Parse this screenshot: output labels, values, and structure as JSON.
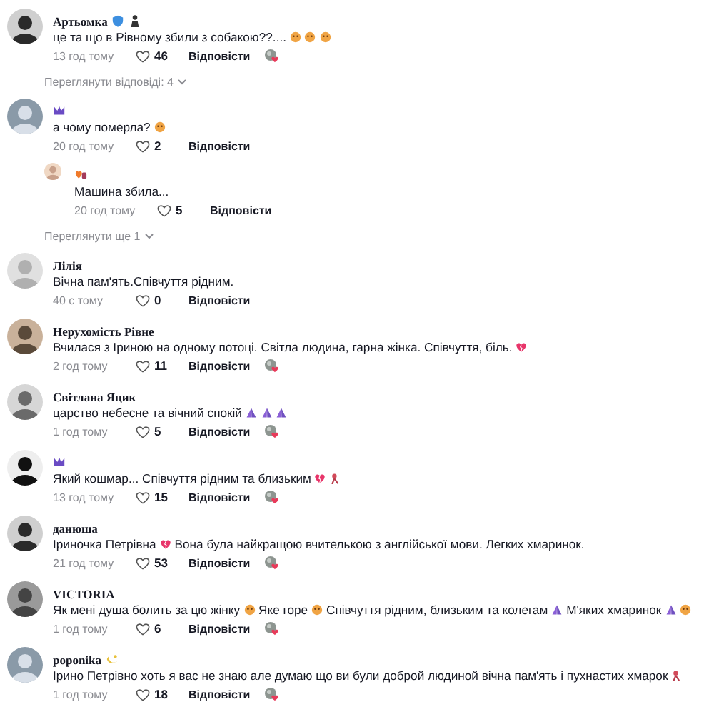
{
  "items": [
    {
      "kind": "comment",
      "author": "Артьомка",
      "badges": [
        {
          "kind": "shield"
        },
        {
          "kind": "person"
        }
      ],
      "body": [
        {
          "kind": "text",
          "value": "це та що в Рівному збили з собакою??...."
        },
        {
          "kind": "face"
        },
        {
          "kind": "face"
        },
        {
          "kind": "face"
        }
      ],
      "time": "13 год тому",
      "likes": "46",
      "reply": "Відповісти",
      "creator_liked": true
    },
    {
      "kind": "more",
      "label": "Переглянути відповіді: 4"
    },
    {
      "kind": "comment",
      "badges": [
        {
          "kind": "crown"
        }
      ],
      "body": [
        {
          "kind": "text",
          "value": "а чому померла?"
        },
        {
          "kind": "face"
        }
      ],
      "time": "20 год тому",
      "likes": "2",
      "reply": "Відповісти",
      "creator_liked": false
    },
    {
      "kind": "reply",
      "badges": [
        {
          "kind": "hearts"
        }
      ],
      "body": [
        {
          "kind": "text",
          "value": "Машина збила..."
        }
      ],
      "time": "20 год тому",
      "likes": "5",
      "reply": "Відповісти",
      "creator_liked": false
    },
    {
      "kind": "more",
      "label": "Переглянути ще 1"
    },
    {
      "kind": "comment",
      "author": "Лілія",
      "body": [
        {
          "kind": "text",
          "value": "Вічна пам'ять.Співчуття рідним."
        }
      ],
      "time": "40 с тому",
      "likes": "0",
      "reply": "Відповісти",
      "creator_liked": false
    },
    {
      "kind": "comment",
      "author": "Нерухомість Рівне",
      "body": [
        {
          "kind": "text",
          "value": "Вчилася з Іриною на одному потоці. Світла людина, гарна жінка. Співчуття, біль."
        },
        {
          "kind": "heart"
        }
      ],
      "time": "2 год тому",
      "likes": "11",
      "reply": "Відповісти",
      "creator_liked": true
    },
    {
      "kind": "comment",
      "author": "Світлана Яцик",
      "body": [
        {
          "kind": "text",
          "value": "царство небесне та вічний спокій"
        },
        {
          "kind": "pray"
        },
        {
          "kind": "pray"
        },
        {
          "kind": "pray"
        }
      ],
      "time": "1 год тому",
      "likes": "5",
      "reply": "Відповісти",
      "creator_liked": true
    },
    {
      "kind": "comment",
      "badges": [
        {
          "kind": "crown"
        }
      ],
      "body": [
        {
          "kind": "text",
          "value": "Який кошмар... Співчуття рідним та близьким"
        },
        {
          "kind": "heart"
        },
        {
          "kind": "ribbon"
        }
      ],
      "time": "13 год тому",
      "likes": "15",
      "reply": "Відповісти",
      "creator_liked": true
    },
    {
      "kind": "comment",
      "author": "данюша",
      "body": [
        {
          "kind": "text",
          "value": "Іриночка Петрівна"
        },
        {
          "kind": "heart"
        },
        {
          "kind": "text",
          "value": "Вона була найкращою вчителькою з англійської мови. Легких хмаринок."
        }
      ],
      "time": "21 год тому",
      "likes": "53",
      "reply": "Відповісти",
      "creator_liked": true
    },
    {
      "kind": "comment",
      "author": "VICTORIA",
      "body": [
        {
          "kind": "text",
          "value": "Як мені душа болить за цю жінку"
        },
        {
          "kind": "face"
        },
        {
          "kind": "text",
          "value": "Яке горе"
        },
        {
          "kind": "face"
        },
        {
          "kind": "text",
          "value": "Співчуття рідним, близьким та колегам"
        },
        {
          "kind": "pray"
        },
        {
          "kind": "text",
          "value": "М'яких хмаринок"
        },
        {
          "kind": "pray"
        },
        {
          "kind": "face"
        }
      ],
      "time": "1 год тому",
      "likes": "6",
      "reply": "Відповісти",
      "creator_liked": true
    },
    {
      "kind": "comment",
      "author": "poponika",
      "badges": [
        {
          "kind": "moon"
        }
      ],
      "body": [
        {
          "kind": "text",
          "value": "Ірино Петрівно хоть я вас не знаю але думаю що ви були доброй людиной вічна пам'ять і пухнастих хмарок"
        },
        {
          "kind": "ribbon"
        }
      ],
      "time": "1 год тому",
      "likes": "18",
      "reply": "Відповісти",
      "creator_liked": true
    }
  ]
}
